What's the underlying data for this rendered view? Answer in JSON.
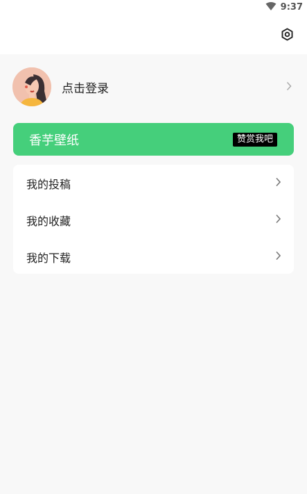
{
  "status": {
    "time": "9:37"
  },
  "icons": {
    "wifi": "wifi-icon",
    "settings": "settings-gear-icon",
    "chevron": "chevron-right-icon"
  },
  "profile": {
    "login_label": "点击登录"
  },
  "banner": {
    "title": "香芋壁纸",
    "donate_label": "赞赏我吧",
    "color": "#45cf7b"
  },
  "menu": {
    "items": [
      {
        "label": "我的投稿"
      },
      {
        "label": "我的收藏"
      },
      {
        "label": "我的下载"
      }
    ]
  }
}
